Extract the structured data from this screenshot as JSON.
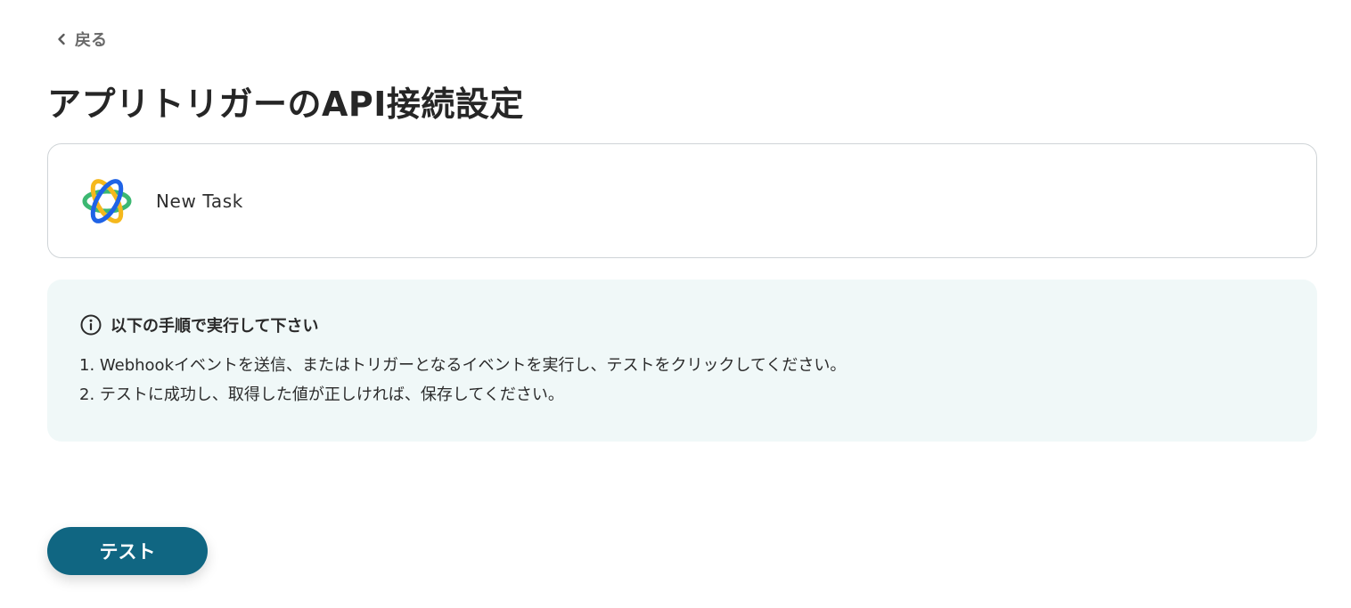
{
  "nav": {
    "back_label": "戻る",
    "back_icon": "chevron-left-icon"
  },
  "page": {
    "title": "アプリトリガーのAPI接続設定"
  },
  "trigger": {
    "app_icon": "orbit-logo-icon",
    "name": "New Task"
  },
  "instructions": {
    "icon": "info-icon",
    "title": "以下の手順で実行して下さい",
    "steps": [
      "1. Webhookイベントを送信、またはトリガーとなるイベントを実行し、テストをクリックしてください。",
      "2. テストに成功し、取得した値が正しければ、保存してください。"
    ]
  },
  "actions": {
    "test_label": "テスト"
  },
  "colors": {
    "accent": "#106682",
    "panel_bg": "#f0f8f8",
    "card_border": "#cfd4d7",
    "logo_blue": "#1f63e6",
    "logo_green": "#3cb872",
    "logo_yellow": "#f5b81c"
  }
}
